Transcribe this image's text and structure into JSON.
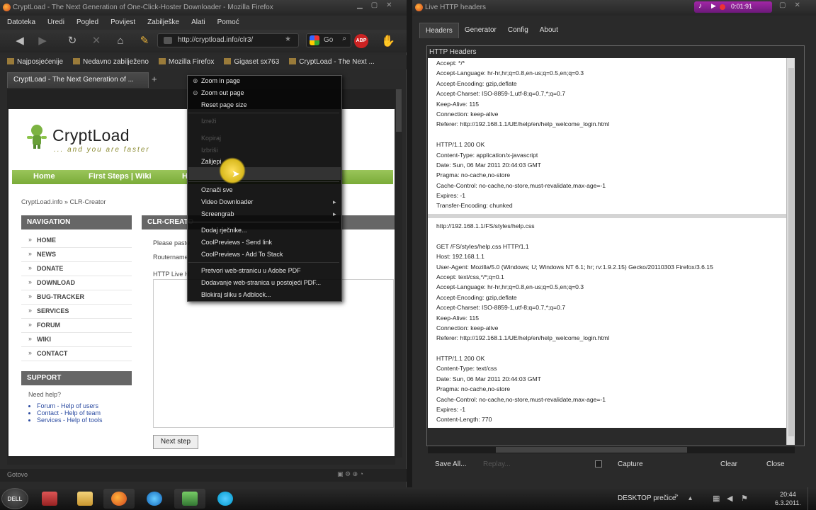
{
  "firefox": {
    "title": "CryptLoad - The Next Generation of One-Click-Hoster Downloader - Mozilla Firefox",
    "menu": [
      "Datoteka",
      "Uredi",
      "Pogled",
      "Povijest",
      "Zabilješke",
      "Alati",
      "Pomoć"
    ],
    "url": "http://cryptload.info/clr3/",
    "search": "Go",
    "abp": "ABP",
    "bookmarks": [
      "Najposjećenije",
      "Nedavno zabilježeno",
      "Mozilla Firefox",
      "Gigaset sx763",
      "CryptLoad - The Next ..."
    ],
    "tab": "CryptLoad - The Next Generation of ...",
    "status": "Gotovo"
  },
  "page": {
    "logo_title": "CryptLoad",
    "logo_sub": "... and you are faster",
    "topnav": [
      "Home",
      "First Steps | Wiki",
      "H"
    ],
    "breadcrumb": "CryptLoad.info » CLR-Creator",
    "nav_title": "NAVIGATION",
    "nav_items": [
      "HOME",
      "NEWS",
      "DONATE",
      "DOWNLOAD",
      "BUG-TRACKER",
      "SERVICES",
      "FORUM",
      "WIKI",
      "CONTACT"
    ],
    "support_title": "SUPPORT",
    "support_q": "Need help?",
    "support_links": [
      "Forum - Help of users",
      "Contact - Help of team",
      "Services - Help of tools"
    ],
    "clr_title": "CLR-CREATO",
    "please": "Please paste",
    "router": "Routername",
    "http_label": "HTTP Live H",
    "next": "Next step"
  },
  "context_menu": {
    "zoom_in": "Zoom in page",
    "zoom_out": "Zoom out page",
    "reset": "Reset page size",
    "dim1": "Izreži",
    "dim2": "Kopiraj",
    "dim3": "Izbriši",
    "paste": "Zalijepi",
    "select_all": "Označi sve",
    "video": "Video Downloader",
    "screengrab": "Screengrab",
    "dict": "Dodaj rječnike...",
    "cool1": "CoolPreviews - Send link",
    "cool2": "CoolPreviews - Add To Stack",
    "pdf1": "Pretvori web-stranicu u Adobe PDF",
    "pdf2": "Dodavanje web-stranica u postojeći PDF...",
    "adblock": "Blokiraj sliku s Adblock..."
  },
  "live_headers": {
    "title": "Live HTTP headers",
    "recorder": "0:01:91",
    "tabs": [
      "Headers",
      "Generator",
      "Config",
      "About"
    ],
    "box_title": "HTTP Headers",
    "block1": [
      "Accept: */*",
      "Accept-Language: hr-hr,hr;q=0.8,en-us;q=0.5,en;q=0.3",
      "Accept-Encoding: gzip,deflate",
      "Accept-Charset: ISO-8859-1,utf-8;q=0.7,*;q=0.7",
      "Keep-Alive: 115",
      "Connection: keep-alive",
      "Referer: http://192.168.1.1/UE/help/en/help_welcome_login.html",
      "",
      "HTTP/1.1 200 OK",
      "Content-Type: application/x-javascript",
      "Date: Sun, 06 Mar 2011 20:44:03 GMT",
      "Pragma: no-cache,no-store",
      "Cache-Control: no-cache,no-store,must-revalidate,max-age=-1",
      "Expires: -1",
      "Transfer-Encoding: chunked"
    ],
    "block2": [
      "http://192.168.1.1/FS/styles/help.css",
      "",
      "GET /FS/styles/help.css HTTP/1.1",
      "Host: 192.168.1.1",
      "User-Agent: Mozilla/5.0 (Windows; U; Windows NT 6.1; hr; rv:1.9.2.15) Gecko/20110303 Firefox/3.6.15",
      "Accept: text/css,*/*;q=0.1",
      "Accept-Language: hr-hr,hr;q=0.8,en-us;q=0.5,en;q=0.3",
      "Accept-Encoding: gzip,deflate",
      "Accept-Charset: ISO-8859-1,utf-8;q=0.7,*;q=0.7",
      "Keep-Alive: 115",
      "Connection: keep-alive",
      "Referer: http://192.168.1.1/UE/help/en/help_welcome_login.html",
      "",
      "HTTP/1.1 200 OK",
      "Content-Type: text/css",
      "Date: Sun, 06 Mar 2011 20:44:03 GMT",
      "Pragma: no-cache,no-store",
      "Cache-Control: no-cache,no-store,must-revalidate,max-age=-1",
      "Expires: -1",
      "Content-Length: 770"
    ],
    "save_all": "Save All...",
    "replay": "Replay...",
    "capture": "Capture",
    "clear": "Clear",
    "close": "Close"
  },
  "taskbar": {
    "start": "DELL",
    "desktop": "DESKTOP prečice",
    "time": "20:44",
    "date": "6.3.2011."
  }
}
